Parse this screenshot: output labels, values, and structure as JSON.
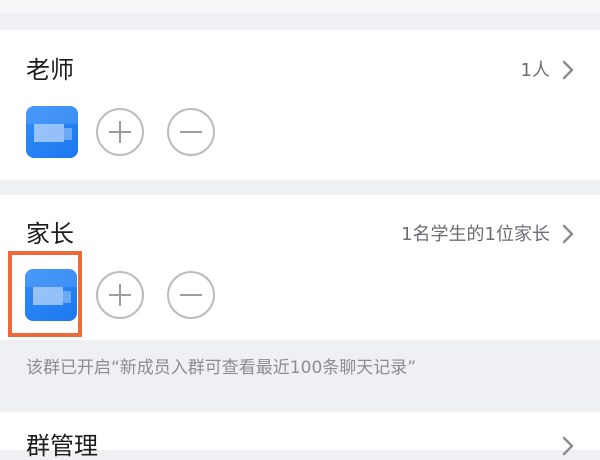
{
  "teachers": {
    "title": "老师",
    "count": "1人",
    "add_icon": "plus-circle-icon",
    "remove_icon": "minus-circle-icon"
  },
  "parents": {
    "title": "家长",
    "count": "1名学生的1位家长",
    "add_icon": "plus-circle-icon",
    "remove_icon": "minus-circle-icon"
  },
  "notice": {
    "text": "该群已开启“新成员入群可查看最近100条聊天记录”"
  },
  "group_manage": {
    "title": "群管理"
  },
  "colors": {
    "avatar_blue": "#2f8cf8",
    "highlight_orange": "#ef6a3a",
    "muted_text": "#8a8d93"
  }
}
